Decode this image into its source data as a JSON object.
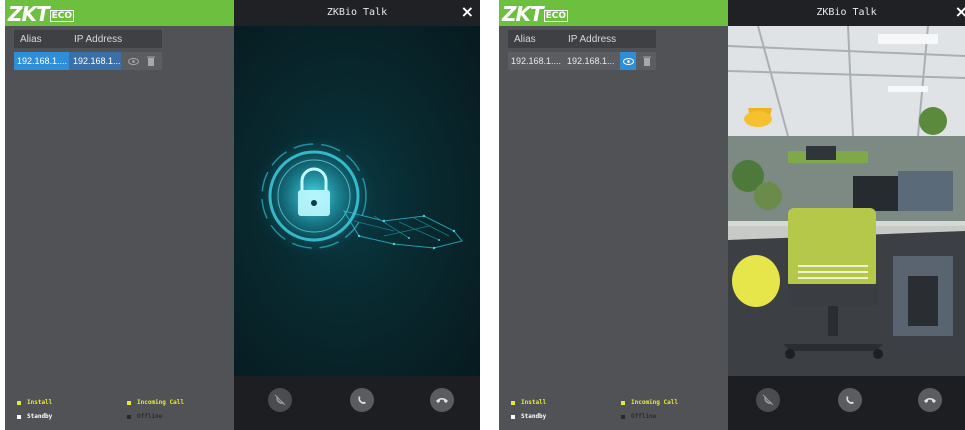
{
  "screens": [
    {
      "brand": {
        "logo_main": "ZKT",
        "logo_sub": "ECO"
      },
      "table": {
        "col_alias": "Alias",
        "col_ip": "IP Address"
      },
      "device": {
        "alias": "192.168.1....",
        "ip": "192.168.1...."
      },
      "talk": {
        "title": "ZKBio Talk",
        "close": "×"
      },
      "legend": {
        "install": "Install",
        "incoming": "Incoming Call",
        "standby": "Standby",
        "offline": "Offline"
      }
    },
    {
      "brand": {
        "logo_main": "ZKT",
        "logo_sub": "ECO"
      },
      "table": {
        "col_alias": "Alias",
        "col_ip": "IP Address"
      },
      "device": {
        "alias": "192.168.1....",
        "ip": "192.168.1...."
      },
      "talk": {
        "title": "ZKBio Talk",
        "close": "×"
      },
      "legend": {
        "install": "Install",
        "incoming": "Incoming Call",
        "standby": "Standby",
        "offline": "Offline"
      }
    }
  ],
  "colors": {
    "brand_green": "#6cbf3f",
    "selection_blue": "#2f8ed8",
    "legend_yellow": "#e8e83a",
    "legend_white": "#ffffff",
    "legend_dark": "#2a2a2a"
  },
  "icons": {
    "view": "eye-icon",
    "delete": "trash-icon",
    "mute": "mic-off-icon",
    "answer": "phone-icon",
    "hangup": "hangup-icon",
    "close": "close-icon"
  }
}
